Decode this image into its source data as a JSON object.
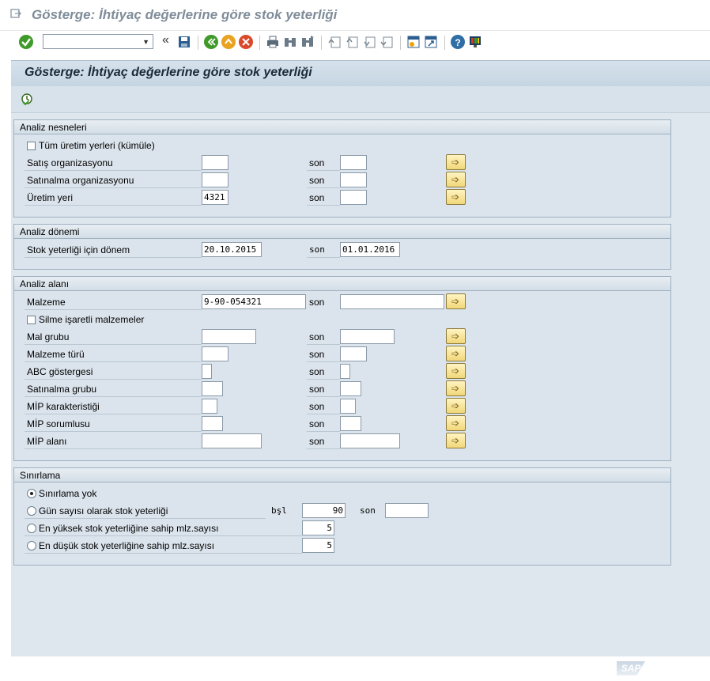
{
  "window": {
    "title": "Gösterge: İhtiyaç değerlerine göre stok yeterliği"
  },
  "toolbar": {
    "command_field_value": "",
    "back_label": "«",
    "icons": [
      "enter-icon",
      "save-icon",
      "back-icon",
      "exit-icon",
      "cancel-icon",
      "print-icon",
      "find-icon",
      "find-next-icon",
      "first-page-icon",
      "previous-page-icon",
      "next-page-icon",
      "last-page-icon",
      "create-session-icon",
      "shortcut-icon",
      "help-icon",
      "customize-layout-icon"
    ]
  },
  "page": {
    "title": "Gösterge: İhtiyaç değerlerine göre stok yeterliği",
    "execute_icon": "execute-icon"
  },
  "groups": {
    "analysis_objects": {
      "title": "Analiz nesneleri",
      "all_plants_label": "Tüm üretim yerleri (kümüle)",
      "all_plants_checked": false,
      "rows": [
        {
          "label": "Satış organizasyonu",
          "from": "",
          "to_label": "son",
          "to": ""
        },
        {
          "label": "Satınalma organizasyonu",
          "from": "",
          "to_label": "son",
          "to": ""
        },
        {
          "label": "Üretim yeri",
          "from": "4321",
          "to_label": "son",
          "to": ""
        }
      ]
    },
    "analysis_period": {
      "title": "Analiz dönemi",
      "label": "Stok yeterliği için dönem",
      "from": "20.10.2015",
      "to_label": "son",
      "to": "01.01.2016"
    },
    "analysis_area": {
      "title": "Analiz alanı",
      "deletion_label": "Silme işaretli malzemeler",
      "deletion_checked": false,
      "material": {
        "label": "Malzeme",
        "from": "9-90-054321",
        "to_label": "son",
        "to": ""
      },
      "rows": [
        {
          "label": "Mal grubu",
          "from": "",
          "to_label": "son",
          "to": ""
        },
        {
          "label": "Malzeme türü",
          "from": "",
          "to_label": "son",
          "to": ""
        },
        {
          "label": "ABC göstergesi",
          "from": "",
          "to_label": "son",
          "to": ""
        },
        {
          "label": "Satınalma grubu",
          "from": "",
          "to_label": "son",
          "to": ""
        },
        {
          "label": "MİP karakteristiği",
          "from": "",
          "to_label": "son",
          "to": ""
        },
        {
          "label": "MİP sorumlusu",
          "from": "",
          "to_label": "son",
          "to": ""
        },
        {
          "label": "MİP alanı",
          "from": "",
          "to_label": "son",
          "to": ""
        }
      ]
    },
    "restriction": {
      "title": "Sınırlama",
      "options": [
        {
          "label": "Sınırlama yok",
          "selected": true
        },
        {
          "label": "Gün sayısı olarak stok yeterliği",
          "selected": false,
          "from_label": "bşl",
          "from": "90",
          "to_label": "son",
          "to": ""
        },
        {
          "label": "En yüksek stok yeterliğine sahip mlz.sayısı",
          "selected": false,
          "value": "5"
        },
        {
          "label": "En düşük stok yeterliğine sahip mlz.sayısı",
          "selected": false,
          "value": "5"
        }
      ]
    }
  },
  "footer": {
    "logo": "SAP"
  },
  "colors": {
    "accent": "#dbe4ec",
    "header": "#c5d5e2",
    "button": "#f1d77a"
  }
}
